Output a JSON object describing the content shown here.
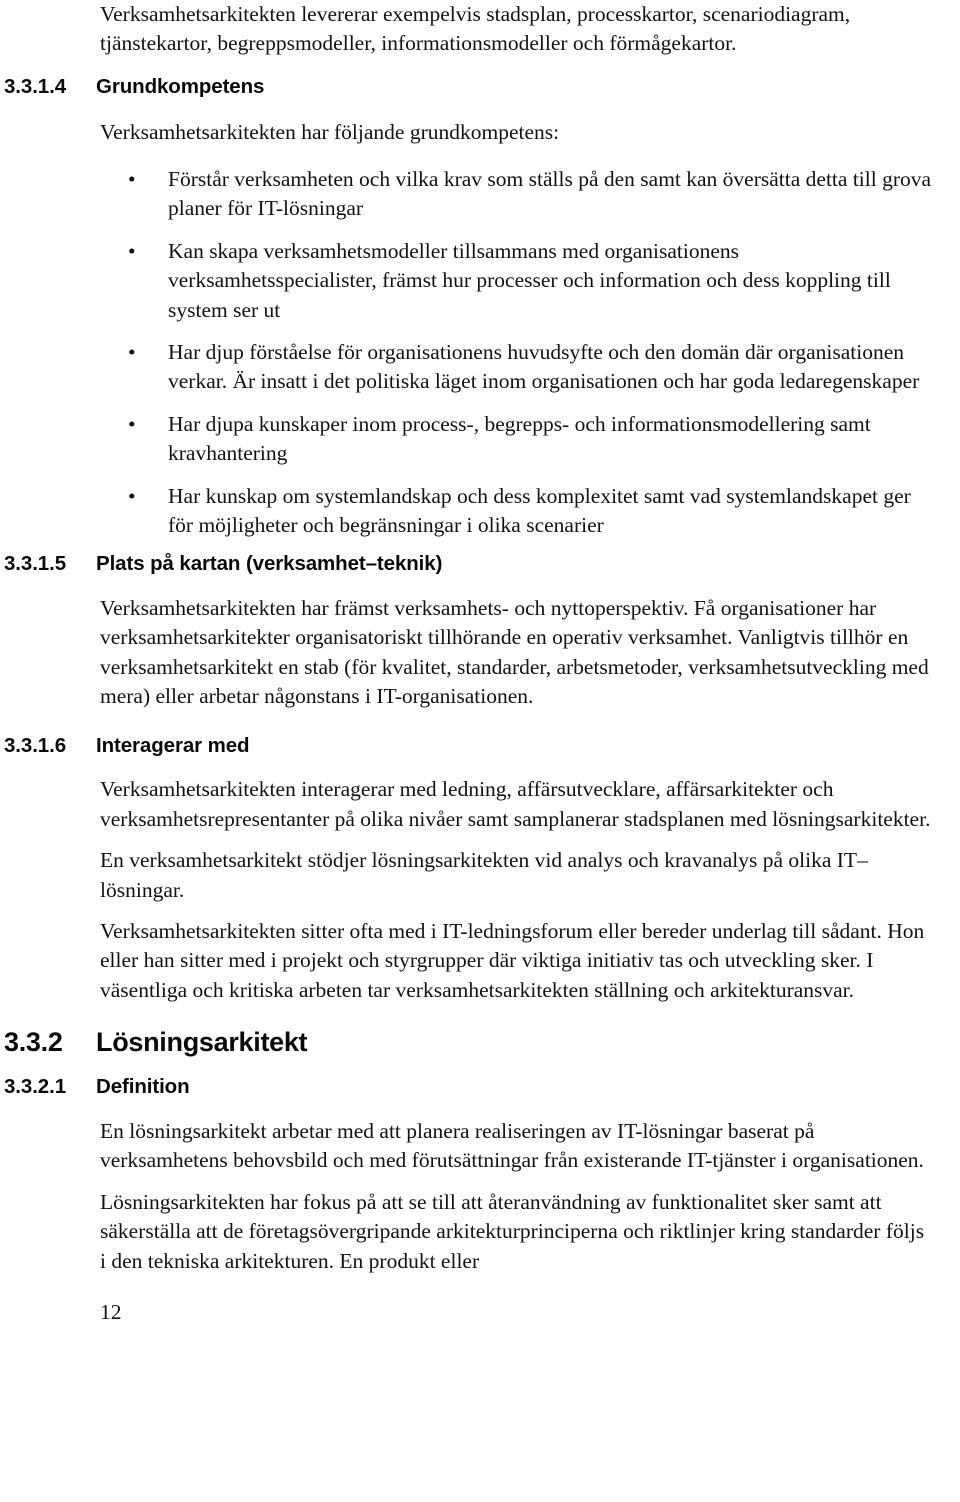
{
  "document": {
    "page_number": "12",
    "language": "sv"
  },
  "intro_paragraph": "Verksamhetsarkitekten levererar exempelvis stadsplan, processkartor, scenariodiagram, tjänstekartor, begreppsmodeller, informationsmodeller och förmågekartor.",
  "sections": {
    "grundkompetens": {
      "number": "3.3.1.4",
      "title": "Grundkompetens",
      "lead": "Verksamhetsarkitekten har följande grundkompetens:",
      "bullet_marker": "•",
      "bullets": [
        "Förstår verksamheten och vilka krav som ställs på den samt kan översätta detta till grova planer för IT-lösningar",
        "Kan skapa verksamhetsmodeller tillsammans med organisationens verksamhetsspecialister, främst hur processer och information och dess koppling till system ser ut",
        "Har djup förståelse för organisationens huvudsyfte och den domän där organisationen verkar. Är insatt i det politiska läget inom organisationen och har goda ledaregenskaper",
        "Har djupa kunskaper inom process-, begrepps- och informationsmodellering samt kravhantering",
        "Har kunskap om systemlandskap och dess komplexitet samt vad systemlandskapet ger för möjligheter och begränsningar i olika scenarier"
      ]
    },
    "plats_pa_kartan": {
      "number": "3.3.1.5",
      "title": "Plats på kartan (verksamhet–teknik)",
      "paragraphs": [
        "Verksamhetsarkitekten har främst verksamhets- och nyttoperspektiv. Få organisationer har verksamhetsarkitekter organisatoriskt tillhörande en operativ verksamhet. Vanligtvis tillhör en verksamhetsarkitekt en stab (för kvalitet, standarder, arbetsmetoder, verksamhetsutveckling med mera) eller arbetar någonstans i IT-organisationen."
      ]
    },
    "interagerar_med": {
      "number": "3.3.1.6",
      "title": "Interagerar med",
      "paragraphs": [
        "Verksamhetsarkitekten interagerar med ledning, affärsutvecklare, affärsarkitekter och verksamhetsrepresentanter på olika nivåer samt samplanerar stadsplanen med lösningsarkitekter.",
        "En verksamhetsarkitekt stödjer lösningsarkitekten vid analys och kravanalys på olika IT–lösningar.",
        "Verksamhetsarkitekten sitter ofta med i IT-ledningsforum eller bereder underlag till sådant. Hon eller han sitter med i projekt och styrgrupper där viktiga initiativ tas och utveckling sker. I väsentliga och kritiska arbeten tar verksamhetsarkitekten ställning och arkitekturansvar."
      ]
    },
    "losningsarkitekt": {
      "number": "3.3.2",
      "title": "Lösningsarkitekt"
    },
    "definition": {
      "number": "3.3.2.1",
      "title": "Definition",
      "paragraphs": [
        "En lösningsarkitekt arbetar med att planera realiseringen av IT-lösningar baserat på verksamhetens behovsbild och med förutsättningar från existerande IT-tjänster i organisationen.",
        "Lösningsarkitekten har fokus på att se till att återanvändning av funktionalitet sker samt att säkerställa att de företagsövergripande arkitekturprinciperna och riktlinjer kring standarder följs i den tekniska arkitekturen. En produkt eller"
      ]
    }
  }
}
